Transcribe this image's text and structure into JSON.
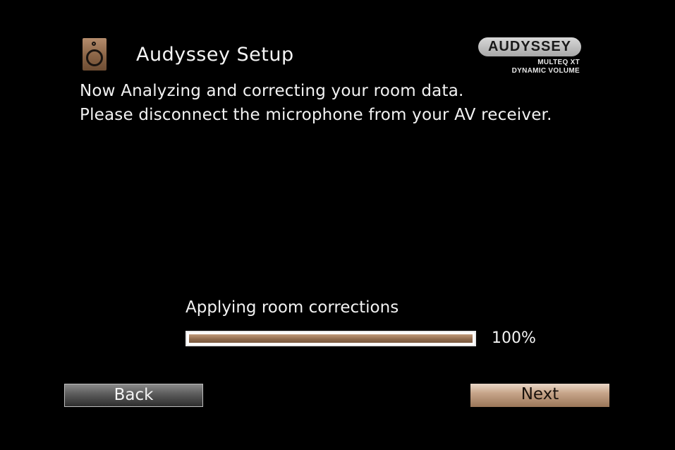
{
  "header": {
    "title": "Audyssey Setup",
    "icon": "speaker-icon"
  },
  "logo": {
    "brand": "AUDYSSEY",
    "line1": "MULTEQ XT",
    "line2": "DYNAMIC VOLUME"
  },
  "messages": {
    "line1": "Now Analyzing and correcting your room data.",
    "line2": "Please disconnect the microphone from your AV receiver."
  },
  "progress": {
    "label": "Applying room corrections",
    "percent": 100,
    "percent_text": "100%"
  },
  "buttons": {
    "back_label": "Back",
    "next_label": "Next"
  },
  "colors": {
    "background": "#000000",
    "accent": "#a9846a",
    "text": "#f2f2f2"
  }
}
